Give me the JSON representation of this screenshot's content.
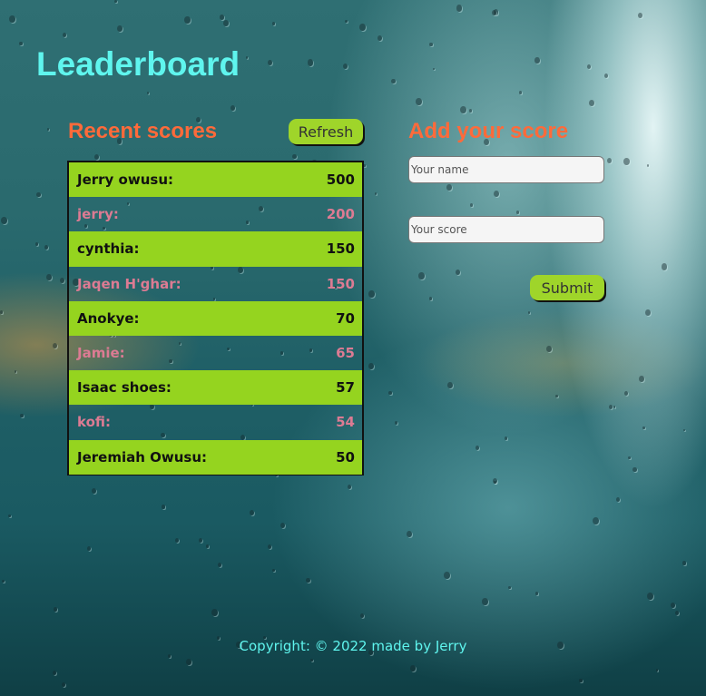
{
  "page": {
    "title": "Leaderboard"
  },
  "recent": {
    "title": "Recent scores",
    "refresh_label": "Refresh",
    "scores": [
      {
        "name": "Jerry owusu:",
        "score": "500"
      },
      {
        "name": "jerry:",
        "score": "200"
      },
      {
        "name": "cynthia:",
        "score": "150"
      },
      {
        "name": "Jaqen H'ghar:",
        "score": "150"
      },
      {
        "name": "Anokye:",
        "score": "70"
      },
      {
        "name": "Jamie:",
        "score": "65"
      },
      {
        "name": "Isaac shoes:",
        "score": "57"
      },
      {
        "name": "kofi:",
        "score": "54"
      },
      {
        "name": "Jeremiah Owusu:",
        "score": "50"
      }
    ]
  },
  "form": {
    "title": "Add your score",
    "name_placeholder": "Your name",
    "score_placeholder": "Your score",
    "submit_label": "Submit"
  },
  "footer": {
    "text": "Copyright: © 2022 made by Jerry"
  },
  "colors": {
    "title": "#5ff5ee",
    "section_title": "#ff6a3a",
    "row_highlight": "#95d41f",
    "row_alt_text": "#dc7b93",
    "button": "#9fd52a"
  }
}
